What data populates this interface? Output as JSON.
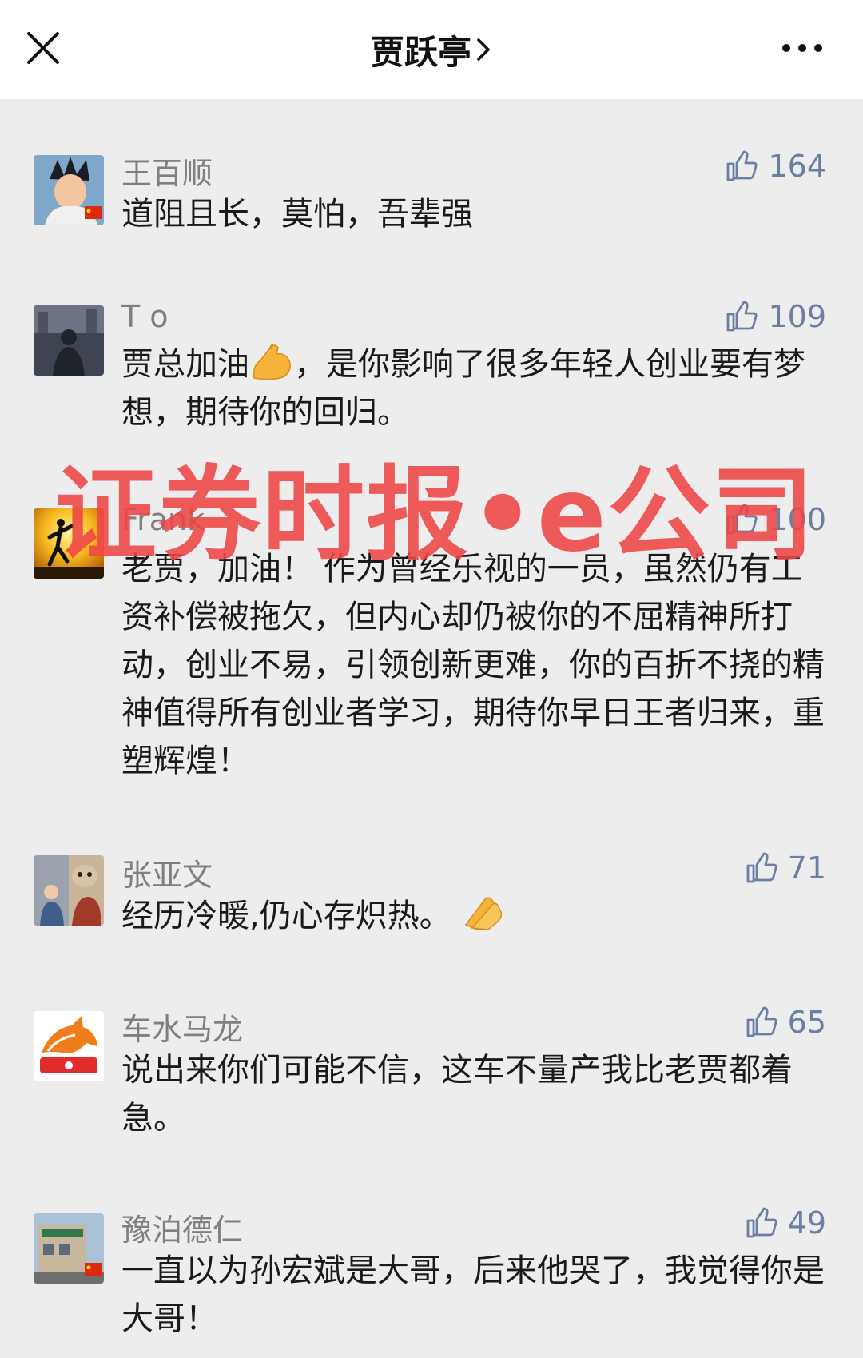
{
  "header": {
    "title": "贾跃亭",
    "close_icon": "close-icon",
    "more_icon": "more-dots-icon"
  },
  "comments": [
    {
      "author": "王百顺",
      "likes": "164",
      "text": "道阻且长，莫怕，吾辈强"
    },
    {
      "author": "T o",
      "likes": "109",
      "text_before_emoji": "贾总加油",
      "emoji": "flexed-biceps-icon",
      "text_after_emoji": "，是你影响了很多年轻人创业要有梦想，期待你的回归。"
    },
    {
      "author": "Frank",
      "likes": "100",
      "text": "老贾，加油！ 作为曾经乐视的一员，虽然仍有工资补偿被拖欠，但内心却仍被你的不屈精神所打动，创业不易，引领创新更难，你的百折不挠的精神值得所有创业者学习，期待你早日王者归来，重塑辉煌！"
    },
    {
      "author": "张亚文",
      "likes": "71",
      "text_before_emoji": "经历冷暖,仍心存炽热。",
      "emoji": "clapping-hands-icon"
    },
    {
      "author": "车水马龙",
      "likes": "65",
      "text": "说出来你们可能不信，这车不量产我比老贾都着急。"
    },
    {
      "author": "豫泊德仁",
      "likes": "49",
      "text": "一直以为孙宏斌是大哥，后来他哭了，我觉得你是大哥！"
    }
  ],
  "watermark": "证券时报•e公司",
  "colors": {
    "background": "#ededed",
    "header_bg": "#ffffff",
    "author": "#7f7f7f",
    "like": "#6b7fa3",
    "text": "#1a1a1a",
    "watermark": "#ee4646"
  }
}
